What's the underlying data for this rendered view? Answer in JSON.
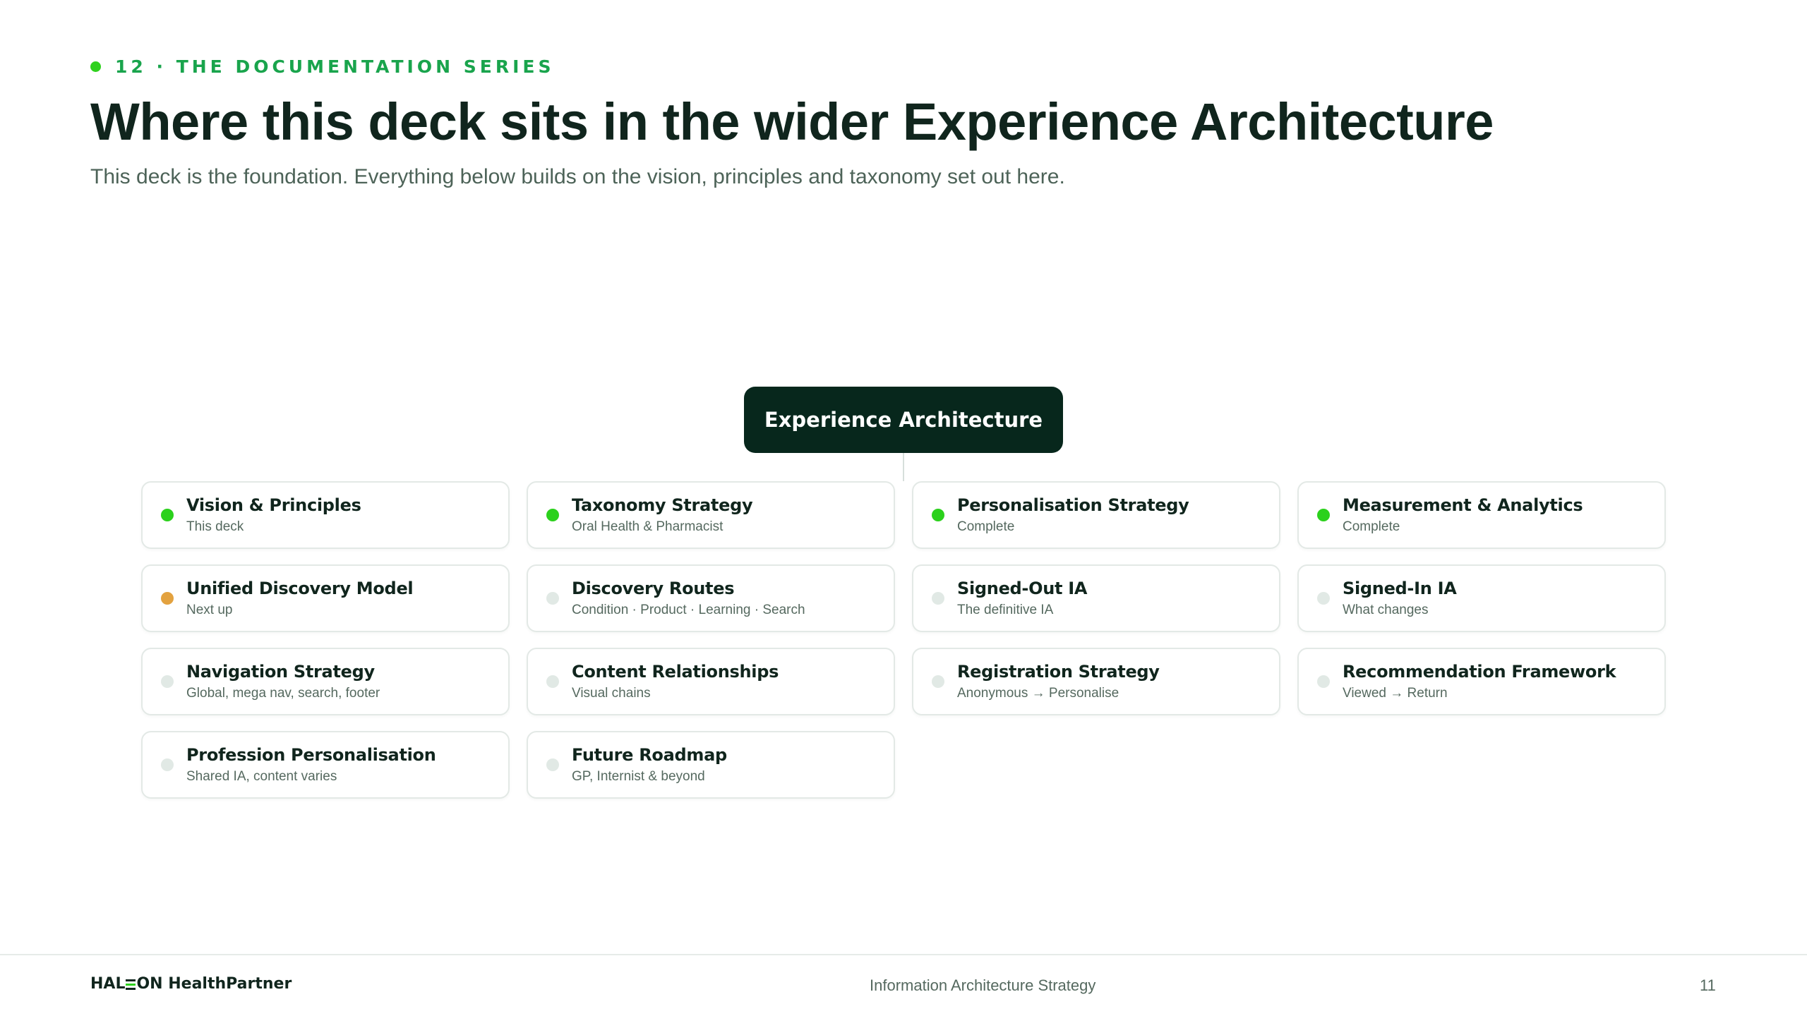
{
  "header": {
    "eyebrow": "12 · THE DOCUMENTATION SERIES",
    "title": "Where this deck sits in the wider Experience Architecture",
    "subtitle": "This deck is the foundation. Everything below builds on the vision, principles and taxonomy set out here."
  },
  "root": {
    "label": "Experience Architecture"
  },
  "colors": {
    "complete": "#2bd11c",
    "next": "#e3a23f",
    "planned": "#e1e9e5",
    "dark": "#07271c"
  },
  "cards": [
    {
      "title": "Vision & Principles",
      "subtitle": "This deck",
      "status": "complete"
    },
    {
      "title": "Taxonomy Strategy",
      "subtitle": "Oral Health & Pharmacist",
      "status": "complete"
    },
    {
      "title": "Personalisation Strategy",
      "subtitle": "Complete",
      "status": "complete"
    },
    {
      "title": "Measurement & Analytics",
      "subtitle": "Complete",
      "status": "complete"
    },
    {
      "title": "Unified Discovery Model",
      "subtitle": "Next up",
      "status": "next"
    },
    {
      "title": "Discovery Routes",
      "subtitle": "Condition · Product · Learning · Search",
      "status": "planned"
    },
    {
      "title": "Signed-Out IA",
      "subtitle": "The definitive IA",
      "status": "planned"
    },
    {
      "title": "Signed-In IA",
      "subtitle": "What changes",
      "status": "planned"
    },
    {
      "title": "Navigation Strategy",
      "subtitle": "Global, mega nav, search, footer",
      "status": "planned"
    },
    {
      "title": "Content Relationships",
      "subtitle": "Visual chains",
      "status": "planned"
    },
    {
      "title": "Registration Strategy",
      "subtitle": "Anonymous → Personalise",
      "status": "planned"
    },
    {
      "title": "Recommendation Framework",
      "subtitle": "Viewed → Return",
      "status": "planned"
    },
    {
      "title": "Profession Personalisation",
      "subtitle": "Shared IA, content varies",
      "status": "planned"
    },
    {
      "title": "Future Roadmap",
      "subtitle": "GP, Internist & beyond",
      "status": "planned"
    }
  ],
  "footer": {
    "logo_left": "HAL",
    "logo_right": "ON HealthPartner",
    "center": "Information Architecture Strategy",
    "page": "11"
  }
}
